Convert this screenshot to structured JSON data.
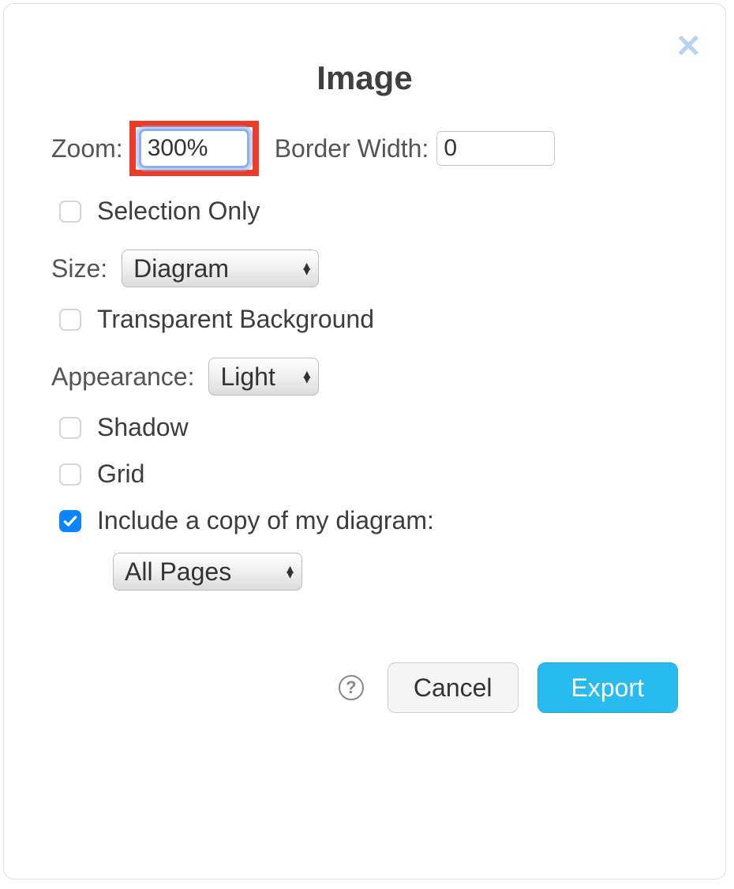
{
  "dialog": {
    "title": "Image",
    "zoom_label": "Zoom:",
    "zoom_value": "300%",
    "border_width_label": "Border Width:",
    "border_width_value": "0",
    "selection_only_label": "Selection Only",
    "selection_only_checked": false,
    "size_label": "Size:",
    "size_value": "Diagram",
    "transparent_bg_label": "Transparent Background",
    "transparent_bg_checked": false,
    "appearance_label": "Appearance:",
    "appearance_value": "Light",
    "shadow_label": "Shadow",
    "shadow_checked": false,
    "grid_label": "Grid",
    "grid_checked": false,
    "include_copy_label": "Include a copy of my diagram:",
    "include_copy_checked": true,
    "include_scope_value": "All Pages",
    "help_glyph": "?",
    "cancel_label": "Cancel",
    "export_label": "Export"
  }
}
